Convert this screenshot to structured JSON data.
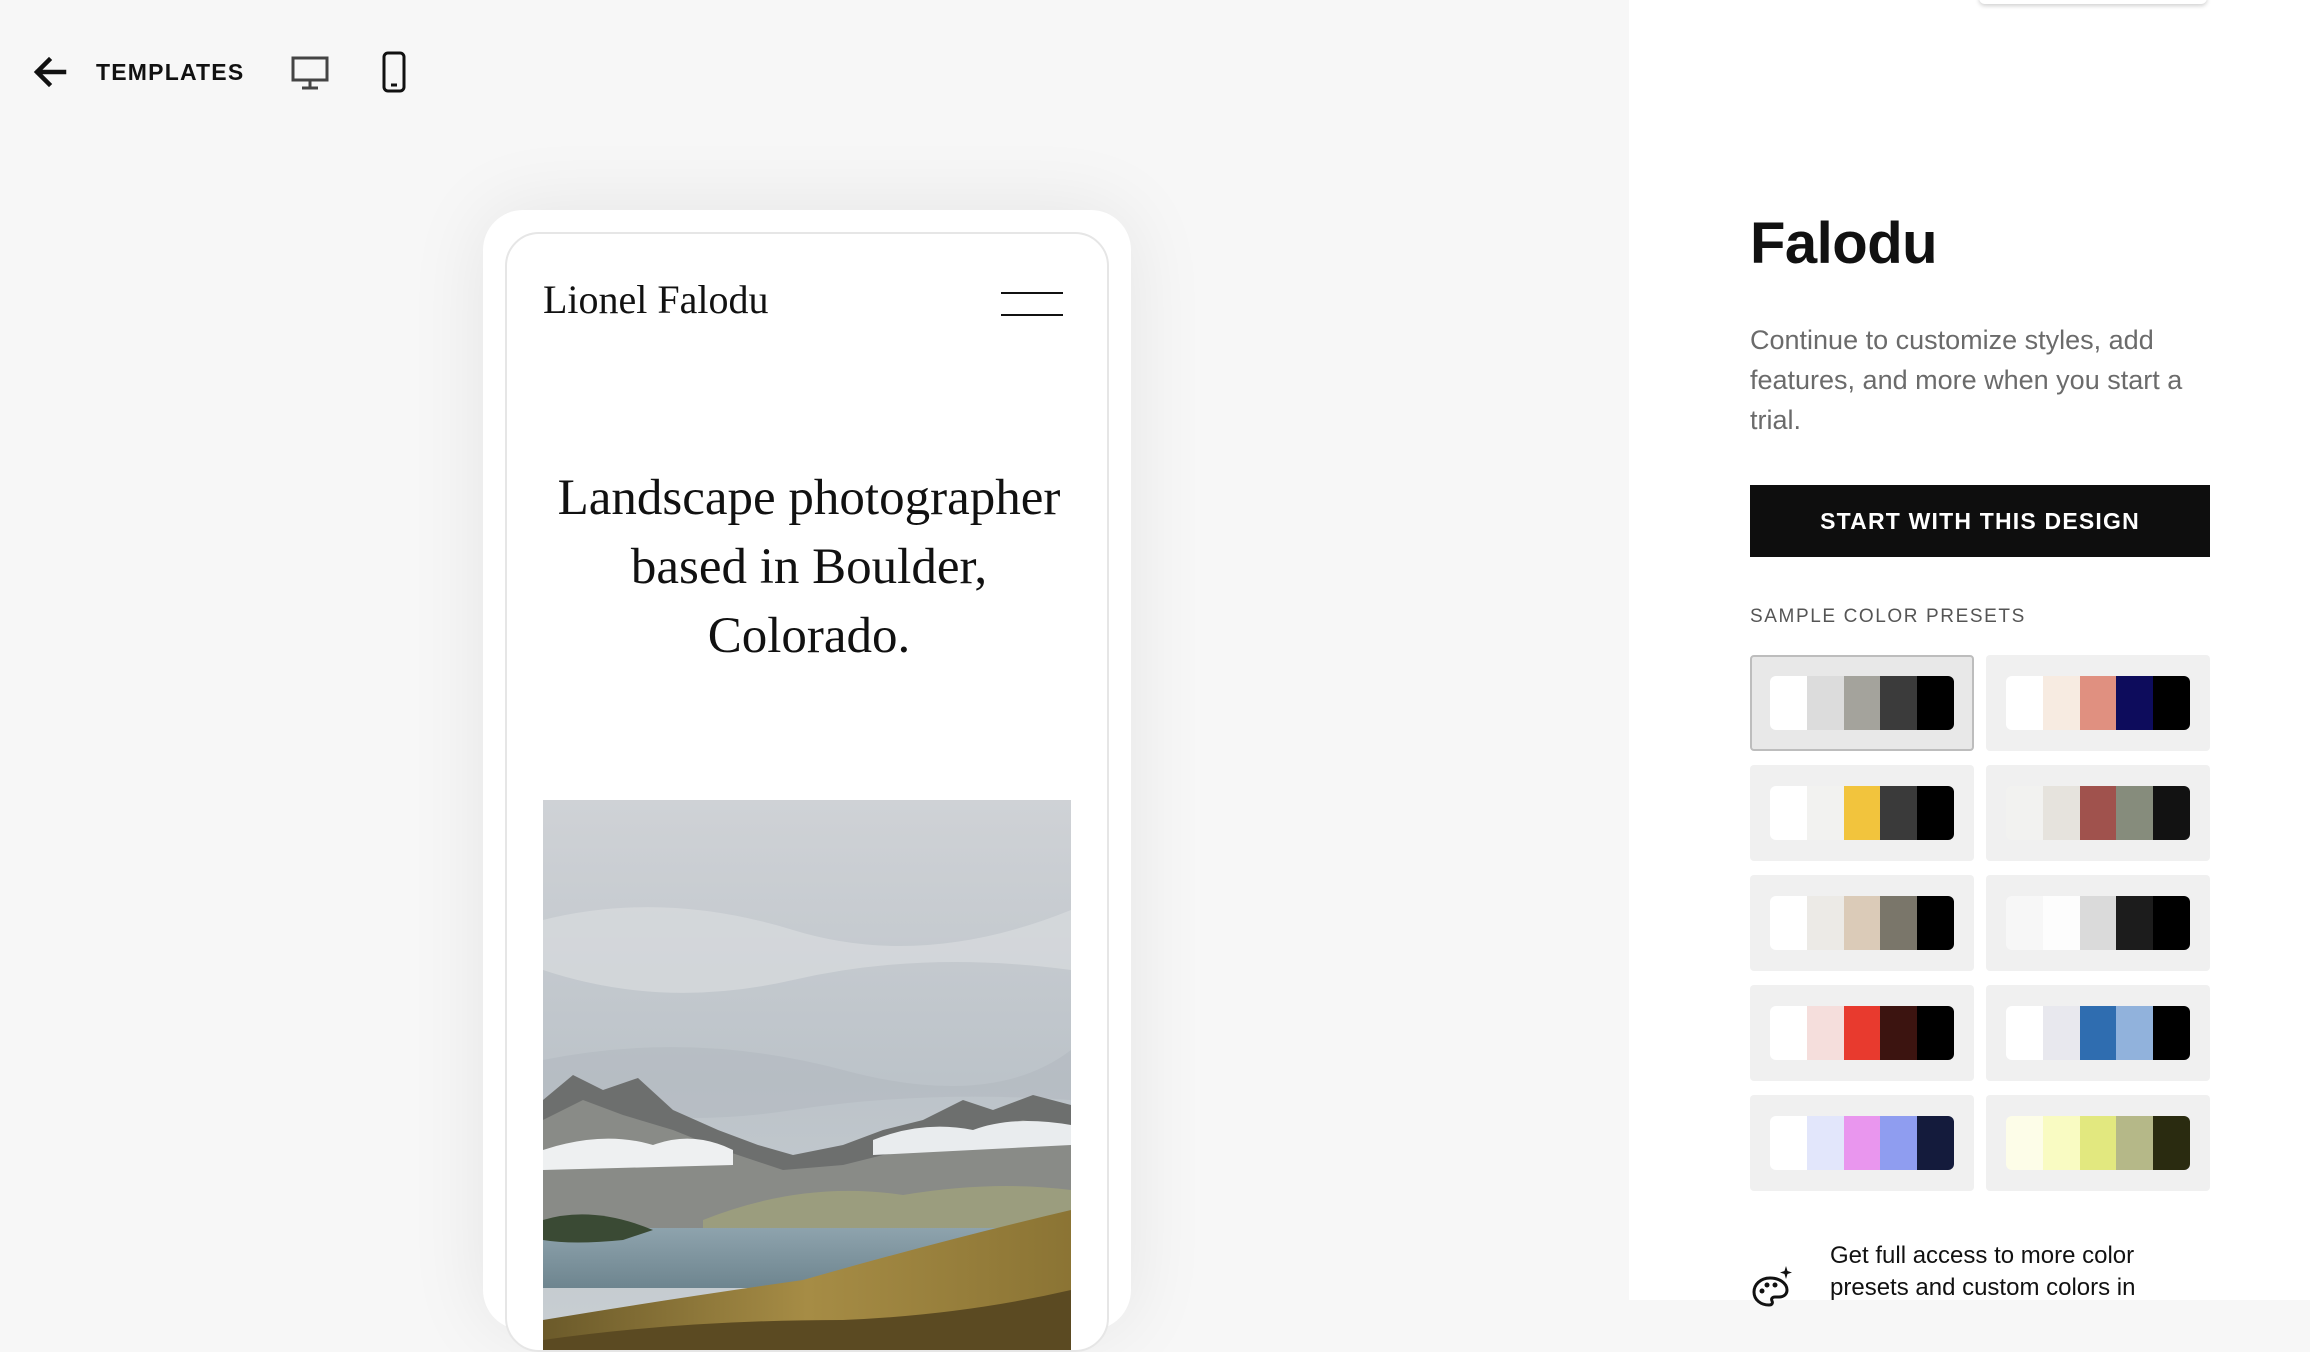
{
  "topbar": {
    "back_label": "TEMPLATES",
    "icons": [
      "arrow-left-icon",
      "desktop-icon",
      "mobile-icon"
    ]
  },
  "preview": {
    "site_name": "Lionel Falodu",
    "headline": "Landscape photographer based in Boulder, Colorado.",
    "hero_image": "mountain-lake-landscape"
  },
  "panel": {
    "title": "Falodu",
    "description": "Continue to customize styles, add features, and more when you start a trial.",
    "start_button": "START WITH THIS DESIGN",
    "presets_label": "SAMPLE COLOR PRESETS",
    "selected_preset": 0,
    "presets": [
      [
        "#ffffff",
        "#dcdcdc",
        "#a4a39c",
        "#3b3b3b",
        "#000000"
      ],
      [
        "#ffffff",
        "#f7ebe1",
        "#e09080",
        "#0d0c5c",
        "#000000"
      ],
      [
        "#ffffff",
        "#f2f2f0",
        "#f2c43d",
        "#3a3a3a",
        "#000000"
      ],
      [
        "#f2f2f0",
        "#e6e3dd",
        "#a0524d",
        "#868c7c",
        "#121212"
      ],
      [
        "#ffffff",
        "#eceae6",
        "#dbcbb8",
        "#7a766a",
        "#000000"
      ],
      [
        "#f7f7f7",
        "#fdfdfd",
        "#dadada",
        "#1c1c1c",
        "#000000"
      ],
      [
        "#ffffff",
        "#f5dedc",
        "#e83a2e",
        "#3c1410",
        "#000000"
      ],
      [
        "#ffffff",
        "#e8e8ee",
        "#2f6db0",
        "#91b2dc",
        "#000000"
      ],
      [
        "#ffffff",
        "#e2e6fb",
        "#e996ee",
        "#8f9df0",
        "#141b3c"
      ],
      [
        "#fdfde8",
        "#f9fbc2",
        "#e2e87f",
        "#b5b888",
        "#2a2b10"
      ]
    ],
    "access_text": "Get full access to more color presets and custom colors in",
    "access_icon": "palette-sparkle-icon"
  }
}
